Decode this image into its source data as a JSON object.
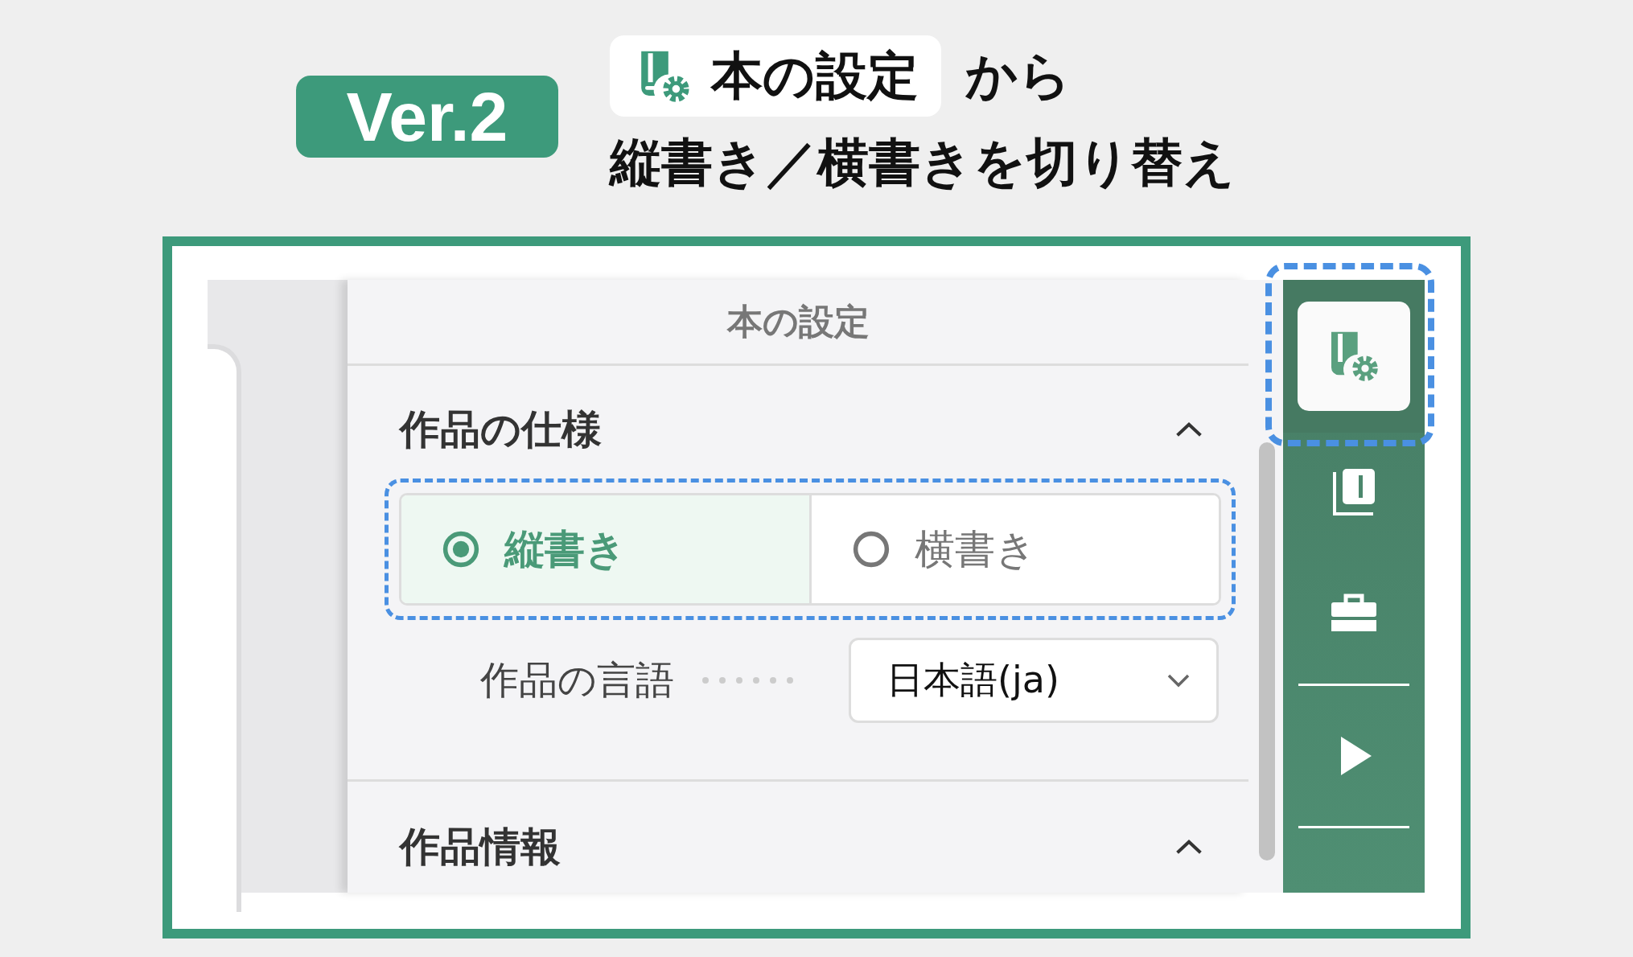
{
  "badge": "Ver.2",
  "heading": {
    "chip": "本の設定",
    "suffix": "から",
    "line2": "縦書き／横書きを切り替え"
  },
  "panel": {
    "title": "本の設定"
  },
  "sections": [
    {
      "title": "作品の仕様",
      "expanded": true
    },
    {
      "title": "作品情報",
      "expanded": true
    }
  ],
  "writing_mode": [
    {
      "label": "縦書き",
      "selected": true
    },
    {
      "label": "横書き",
      "selected": false
    }
  ],
  "language": {
    "label": "作品の言語",
    "value": "日本語(ja)"
  },
  "sidebar": [
    {
      "kind": "book-settings",
      "selected": true
    },
    {
      "kind": "pages",
      "selected": false
    },
    {
      "kind": "toolbox",
      "selected": false
    },
    {
      "kind": "play",
      "selected": false
    }
  ]
}
